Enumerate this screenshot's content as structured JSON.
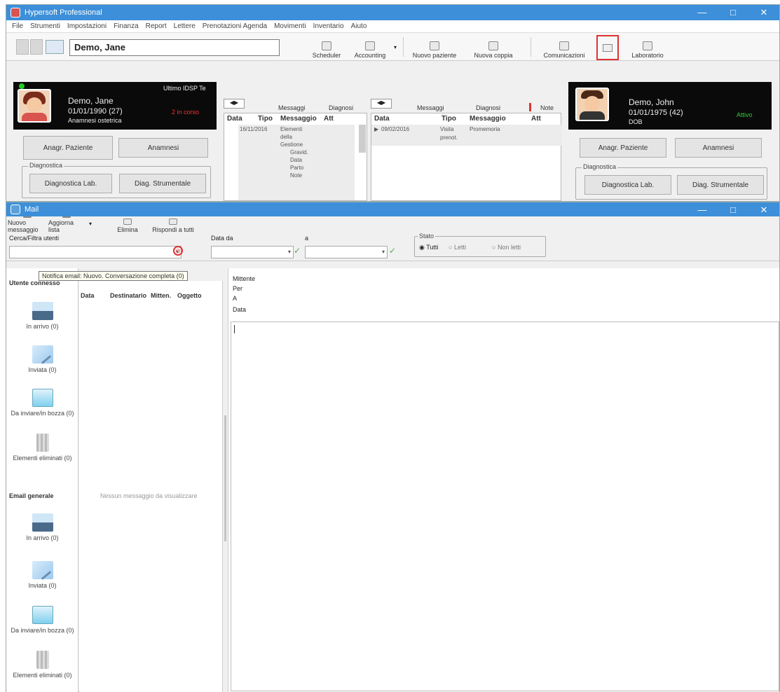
{
  "main_window": {
    "title": "Hypersoft Professional",
    "menu": [
      "File",
      "Strumenti",
      "Impostazioni",
      "Finanza",
      "Report",
      "Lettere",
      "Prenotazioni Agenda",
      "Movimenti",
      "Inventario",
      "Aiuto"
    ],
    "patient_search": "Demo, Jane",
    "toolbar": {
      "scheduler": "Scheduler",
      "accounting": "Accounting",
      "nuovo_paziente": "Nuovo paziente",
      "nuova_coppia": "Nuova coppia",
      "comunicazioni": "Comunicazioni",
      "laboratorio": "Laboratorio"
    }
  },
  "patient_left": {
    "name": "Demo, Jane",
    "dob": "01/01/1990 (27)",
    "extra": "Anamnesi ostetrica",
    "tag": "Ultimo IDSP Te",
    "status": "2 in corso",
    "btn_anagrafica": "Anagr. Paziente",
    "btn_anamnesi": "Anamnesi",
    "group_label": "Diagnostica",
    "btn_diagnostica": "Diagnostica Lab.",
    "btn_diag_strumentale": "Diag. Strumentale"
  },
  "patient_right": {
    "name": "Demo, John",
    "dob": "01/01/1975 (42)",
    "extra": "DOB",
    "status": "Attivo",
    "btn_anagrafica": "Anagr. Paziente",
    "btn_anamnesi": "Anamnesi",
    "group_label": "Diagnostica",
    "btn_diagnostica": "Diagnostica Lab.",
    "btn_diag_strumentale": "Diag. Strumentale"
  },
  "panel_left": {
    "tabs": [
      "Messaggi",
      "Diagnosi"
    ],
    "cols": [
      "Data",
      "Tipo",
      "Messaggio",
      "Att"
    ],
    "row": {
      "date": "16/11/2016",
      "lines": [
        "Elementi",
        "della",
        "Gestione",
        "Gravid.",
        "Data",
        "Parto",
        "Note"
      ]
    }
  },
  "panel_mid": {
    "tabs": [
      "Messaggi",
      "Diagnosi",
      "Note"
    ],
    "cols": [
      "Data",
      "Tipo",
      "Messaggio",
      "Att"
    ],
    "row": {
      "date": "09/02/2016",
      "type": "Visita",
      "type2": "prenot.",
      "msg": "Promemoria"
    }
  },
  "mail_window": {
    "title": "Mail",
    "toolbar": {
      "nuovo": "Nuovo messaggio",
      "aggiorna": "Aggiorna lista",
      "elimina": "Elimina",
      "rispondi": "Rispondi a tutti"
    },
    "filters": {
      "search_label": "Cerca/Filtra utenti",
      "date_label": "Data da",
      "a_label": "a",
      "stato_label": "Stato",
      "radio_tutti": "Tutti",
      "radio_letti": "Letti",
      "radio_non_letti": "Non letti"
    },
    "tooltip": "Notifica email: Nuovo. Conversazione completa (0)",
    "nav": {
      "section_personal": "Utente connesso",
      "section_general": "Email generale",
      "items": [
        {
          "label": "In arrivo (0)",
          "icon": "inbox-icon"
        },
        {
          "label": "Inviata (0)",
          "icon": "sent-icon"
        },
        {
          "label": "Da inviare/in bozza (0)",
          "icon": "draft-icon"
        },
        {
          "label": "Elementi eliminati (0)",
          "icon": "trash-icon"
        }
      ],
      "general_items": [
        {
          "label": "In arrivo (0)",
          "icon": "inbox-icon"
        },
        {
          "label": "Inviata (0)",
          "icon": "sent-icon"
        },
        {
          "label": "Da inviare/in bozza (0)",
          "icon": "draft-icon"
        },
        {
          "label": "Elementi eliminati (0)",
          "icon": "trash-icon"
        }
      ]
    },
    "list": {
      "columns": [
        "Data",
        "Destinatario",
        "Mitten.",
        "Oggetto"
      ],
      "empty_text": "Nessun messaggio da visualizzare"
    },
    "detail": {
      "from_label": "Mittente",
      "to_label": "Per",
      "cc_label": "A",
      "date_label": "Data"
    }
  }
}
